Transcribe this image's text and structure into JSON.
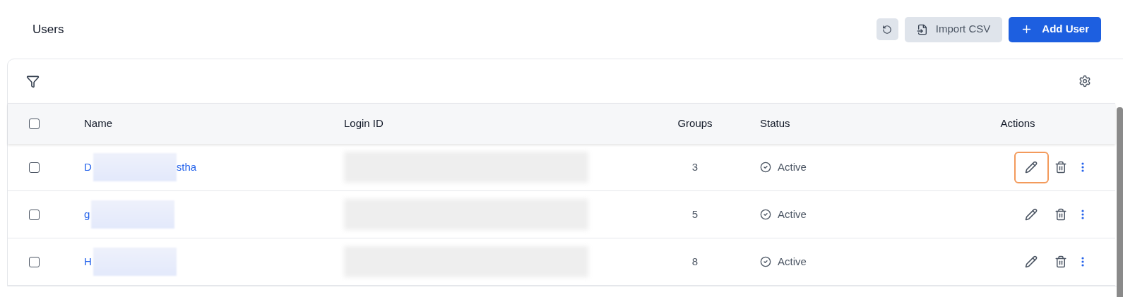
{
  "page": {
    "title": "Users"
  },
  "toolbar": {
    "import_label": "Import CSV",
    "add_label": "Add User"
  },
  "table": {
    "columns": [
      "Name",
      "Login ID",
      "Groups",
      "Status",
      "Actions"
    ],
    "header_checked": false,
    "rows": [
      {
        "checked": false,
        "name_start": "D",
        "name_end": "stha",
        "groups": "3",
        "status": "Active",
        "edit_focused": true
      },
      {
        "checked": false,
        "name_start": "g",
        "name_end": "",
        "groups": "5",
        "status": "Active",
        "edit_focused": false
      },
      {
        "checked": false,
        "name_start": "H",
        "name_end": "",
        "groups": "8",
        "status": "Active",
        "edit_focused": false
      }
    ]
  }
}
